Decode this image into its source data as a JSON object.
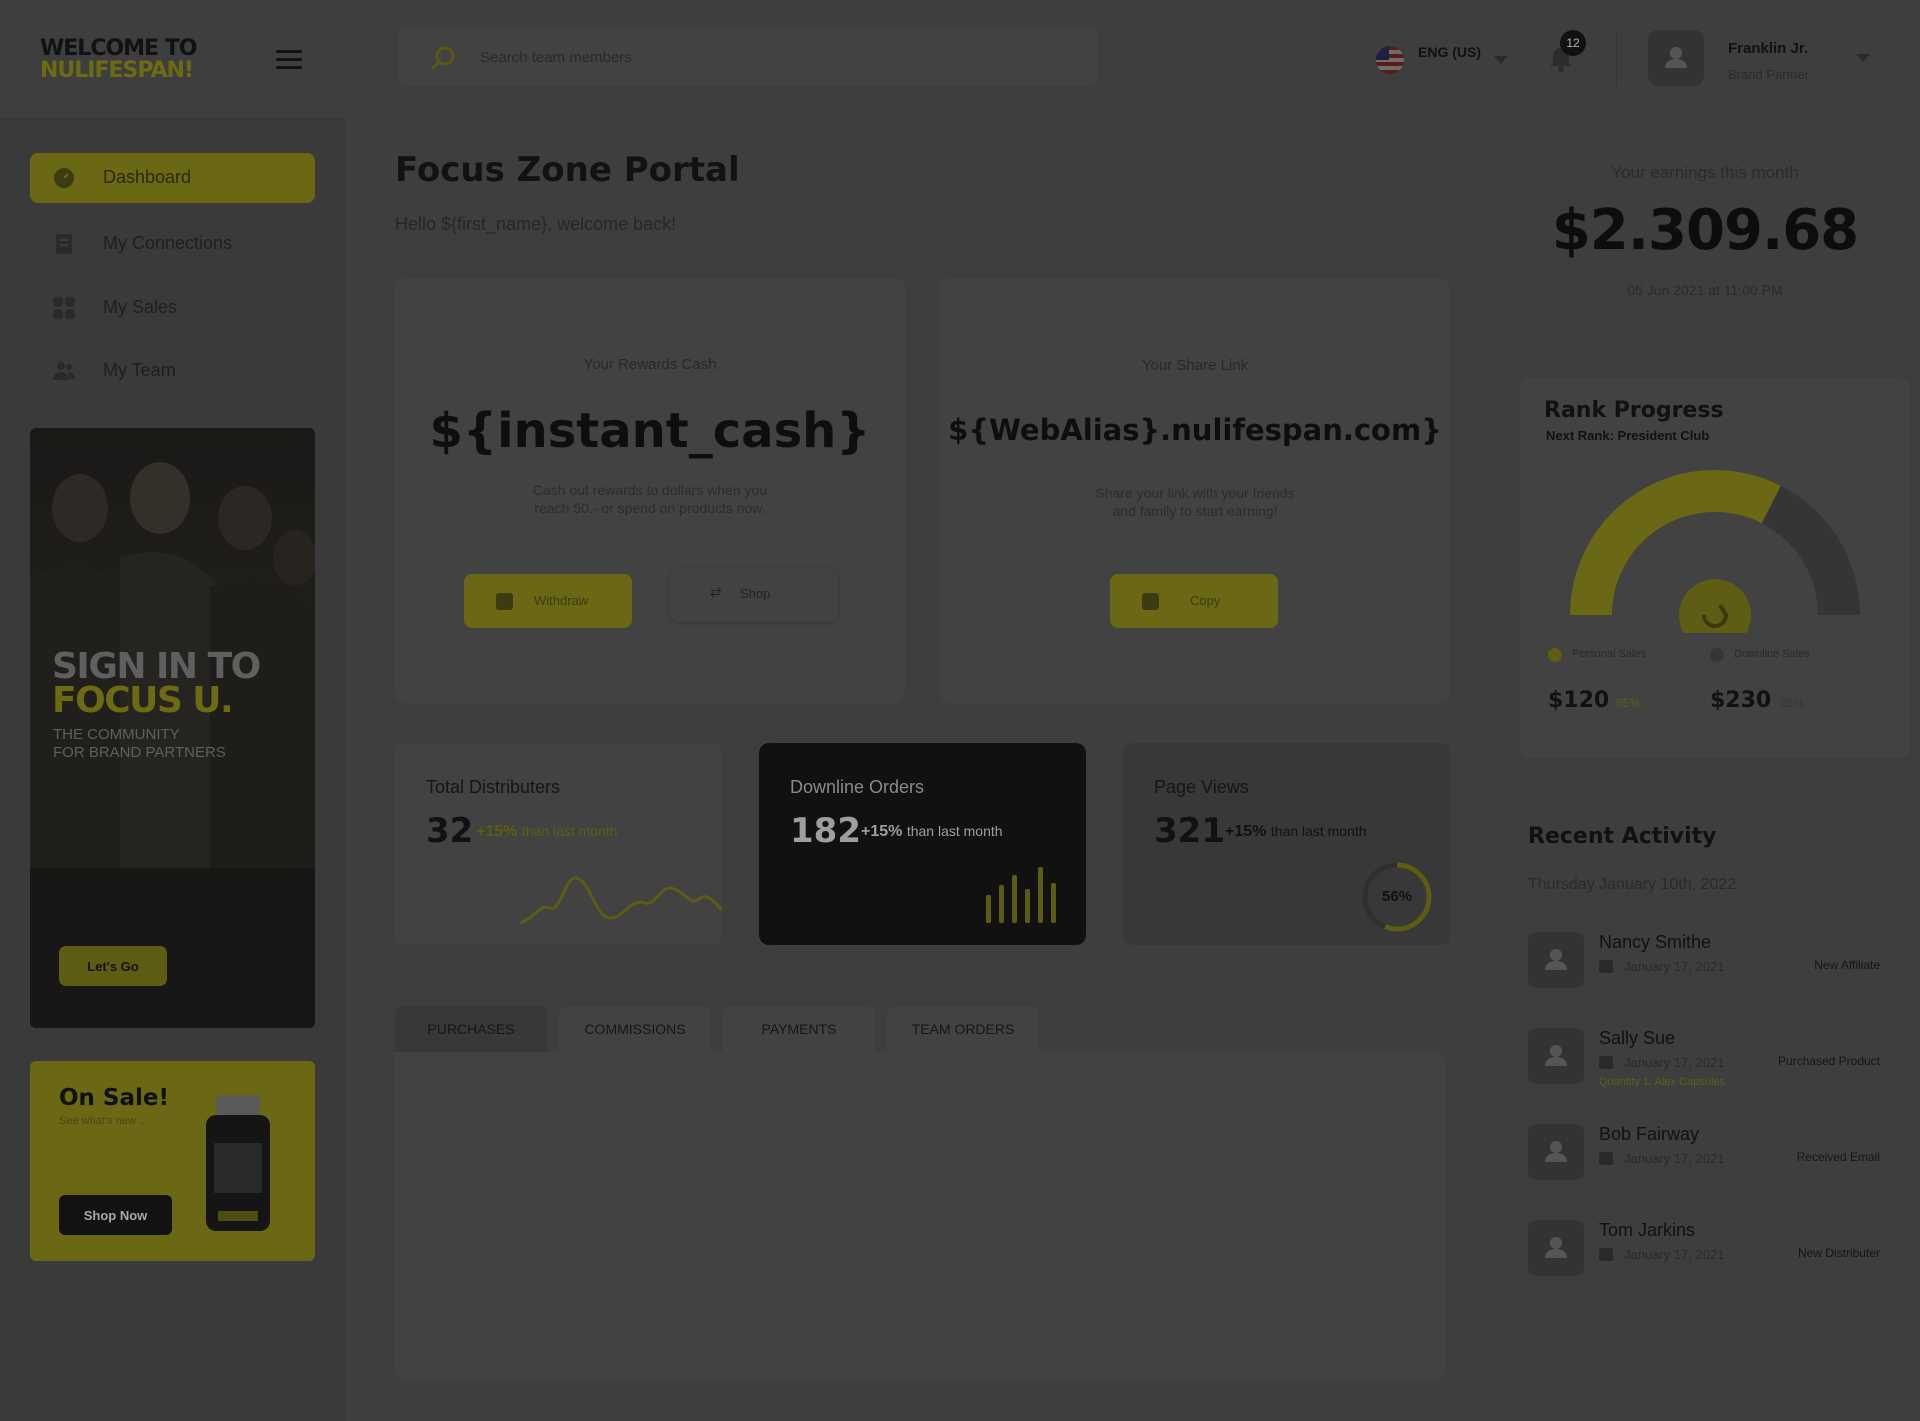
{
  "brand": {
    "logo_line1": "WELCOME TO",
    "logo_line2": "NULIFESPAN!"
  },
  "header": {
    "search_placeholder": "Search team members",
    "language": "ENG (US)",
    "notification_count": "12",
    "user_name": "Franklin Jr.",
    "user_role": "Brand Partner"
  },
  "sidebar": {
    "items": [
      {
        "label": "Dashboard",
        "icon": "dashboard-icon",
        "active": true
      },
      {
        "label": "My Connections",
        "icon": "document-icon",
        "active": false
      },
      {
        "label": "My Sales",
        "icon": "grid-icon",
        "active": false
      },
      {
        "label": "My Team",
        "icon": "team-icon",
        "active": false
      }
    ],
    "promo": {
      "title_line1": "SIGN IN TO",
      "title_line2": "FOCUS U.",
      "sub_line1": "THE COMMUNITY",
      "sub_line2": "FOR BRAND PARTNERS",
      "button": "Let's Go"
    },
    "sale": {
      "title": "On Sale!",
      "subtitle": "See what's new ...",
      "button": "Shop Now"
    }
  },
  "main": {
    "title": "Focus Zone Portal",
    "welcome": "Hello ${first_name}, welcome back!",
    "rewards": {
      "label": "Your Rewards Cash",
      "value": "${instant_cash}",
      "desc_line1": "Cash out rewards to dollars when you",
      "desc_line2": "reach 50.- or spend on products now.",
      "withdraw": "Withdraw",
      "shop": "Shop"
    },
    "share": {
      "label": "Your Share Link",
      "value": "${WebAlias}.nulifespan.com}",
      "desc_line1": "Share your link with your friends",
      "desc_line2": "and family to start earning!",
      "copy": "Copy"
    },
    "stats": [
      {
        "title": "Total Distributers",
        "value": "32",
        "change": "+15%",
        "than": "than last month"
      },
      {
        "title": "Downline Orders",
        "value": "182",
        "change": "+15%",
        "than": "than last month"
      },
      {
        "title": "Page Views",
        "value": "321",
        "change": "+15%",
        "than": "than last month",
        "progress_label": "56%",
        "progress": 0.56
      }
    ],
    "tabs": [
      "PURCHASES",
      "COMMISSIONS",
      "PAYMENTS",
      "TEAM ORDERS"
    ]
  },
  "right": {
    "earnings_label": "Your earnings this month",
    "earnings_value": "$2.309.68",
    "earnings_date": "05 Jun 2021 at 11:00 PM",
    "rank": {
      "title": "Rank Progress",
      "next": "Next Rank: President Club",
      "progress": 0.65,
      "personal_label": "Personal Sales",
      "downline_label": "Downline Sales",
      "personal_amount": "$120",
      "personal_pct": "65%",
      "downline_amount": "$230",
      "downline_pct": "35%"
    },
    "recent": {
      "title": "Recent Activity",
      "date": "Thursday January 10th, 2022",
      "items": [
        {
          "name": "Nancy Smithe",
          "date": "January 17, 2021",
          "type": "New Affiliate",
          "extra": ""
        },
        {
          "name": "Sally Sue",
          "date": "January 17, 2021",
          "type": "Purchased Product",
          "extra": "Quantity 1: Alex Capsules"
        },
        {
          "name": "Bob Fairway",
          "date": "January 17, 2021",
          "type": "Received Email",
          "extra": ""
        },
        {
          "name": "Tom Jarkins",
          "date": "January 17, 2021",
          "type": "New Distributer",
          "extra": ""
        }
      ]
    }
  },
  "colors": {
    "accent": "#6a6814",
    "dark_card": "#111111",
    "overlay_bg": "#3e3e3e"
  }
}
